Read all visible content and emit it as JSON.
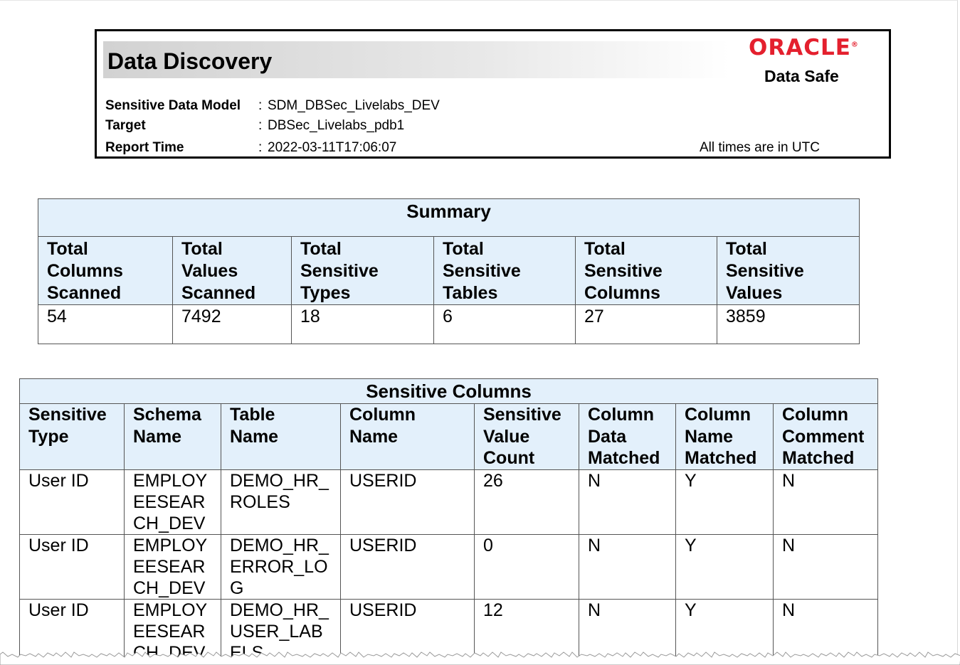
{
  "header": {
    "title": "Data Discovery",
    "brand": "ORACLE",
    "product": "Data Safe",
    "fields": [
      {
        "label": "Sensitive Data Model",
        "value": "SDM_DBSec_Livelabs_DEV"
      },
      {
        "label": "Target",
        "value": "DBSec_Livelabs_pdb1"
      },
      {
        "label": "Report Time",
        "value": "2022-03-11T17:06:07"
      }
    ],
    "timezone_note": "All times are in UTC"
  },
  "summary": {
    "caption": "Summary",
    "columns": [
      {
        "header": [
          "Total",
          "Columns",
          "Scanned"
        ],
        "value": "54"
      },
      {
        "header": [
          "Total",
          "Values",
          "Scanned"
        ],
        "value": "7492"
      },
      {
        "header": [
          "Total",
          "Sensitive",
          "Types"
        ],
        "value": "18"
      },
      {
        "header": [
          "Total",
          "Sensitive",
          "Tables"
        ],
        "value": "6"
      },
      {
        "header": [
          "Total",
          "Sensitive",
          "Columns"
        ],
        "value": "27"
      },
      {
        "header": [
          "Total",
          "Sensitive",
          "Values"
        ],
        "value": "3859"
      }
    ]
  },
  "sensitive_columns": {
    "caption": "Sensitive Columns",
    "headers": [
      [
        "Sensitive",
        "Type"
      ],
      [
        "Schema",
        "Name"
      ],
      [
        "Table",
        "Name"
      ],
      [
        "Column",
        "Name"
      ],
      [
        "Sensitive",
        "Value",
        "Count"
      ],
      [
        "Column",
        "Data",
        "Matched"
      ],
      [
        "Column",
        "Name",
        "Matched"
      ],
      [
        "Column",
        "Comment",
        "Matched"
      ]
    ],
    "rows": [
      [
        [
          "User ID"
        ],
        [
          "EMPLOY",
          "EESEAR",
          "CH_DEV"
        ],
        [
          "DEMO_HR_",
          "ROLES"
        ],
        [
          "USERID"
        ],
        [
          "26"
        ],
        [
          "N"
        ],
        [
          "Y"
        ],
        [
          "N"
        ]
      ],
      [
        [
          "User ID"
        ],
        [
          "EMPLOY",
          "EESEAR",
          "CH_DEV"
        ],
        [
          "DEMO_HR_",
          "ERROR_LO",
          "G"
        ],
        [
          "USERID"
        ],
        [
          "0"
        ],
        [
          "N"
        ],
        [
          "Y"
        ],
        [
          "N"
        ]
      ],
      [
        [
          "User ID"
        ],
        [
          "EMPLOY",
          "EESEAR",
          "CH_DEV"
        ],
        [
          "DEMO_HR_",
          "USER_LAB",
          "ELS"
        ],
        [
          "USERID"
        ],
        [
          "12"
        ],
        [
          "N"
        ],
        [
          "Y"
        ],
        [
          "N"
        ]
      ]
    ]
  }
}
